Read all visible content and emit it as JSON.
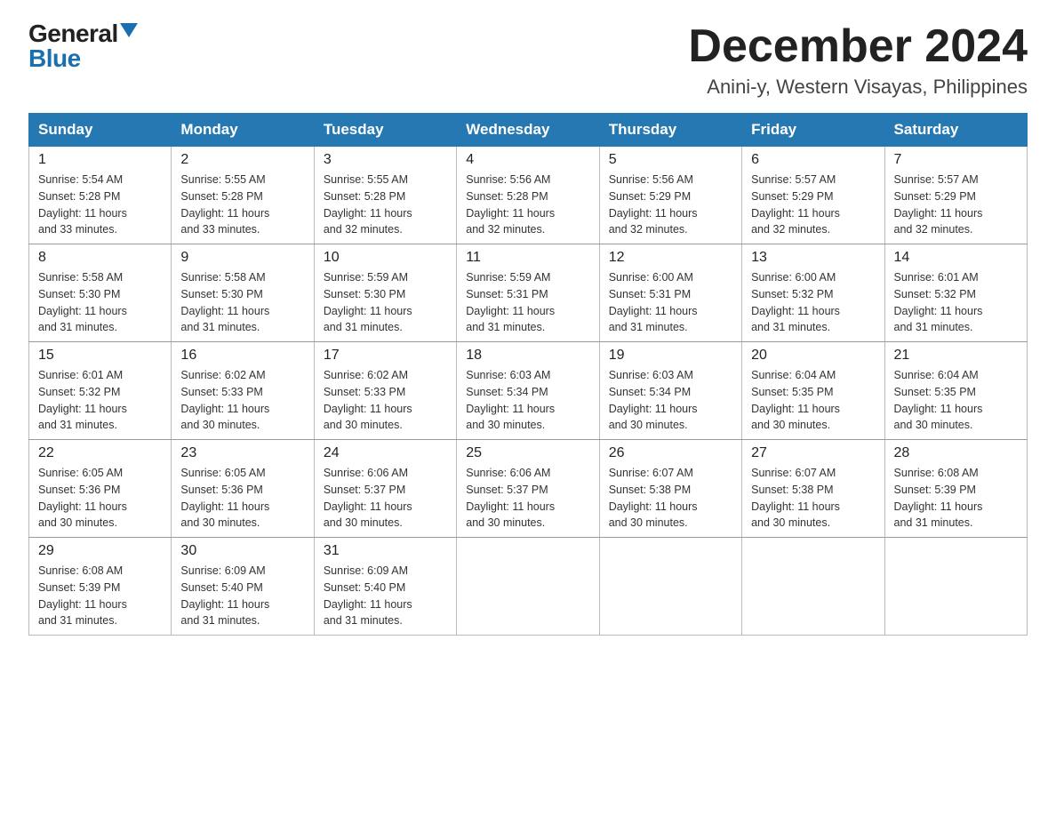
{
  "logo": {
    "general": "General",
    "blue": "Blue"
  },
  "title": {
    "month": "December 2024",
    "location": "Anini-y, Western Visayas, Philippines"
  },
  "weekdays": [
    "Sunday",
    "Monday",
    "Tuesday",
    "Wednesday",
    "Thursday",
    "Friday",
    "Saturday"
  ],
  "weeks": [
    [
      {
        "day": "1",
        "info": "Sunrise: 5:54 AM\nSunset: 5:28 PM\nDaylight: 11 hours\nand 33 minutes."
      },
      {
        "day": "2",
        "info": "Sunrise: 5:55 AM\nSunset: 5:28 PM\nDaylight: 11 hours\nand 33 minutes."
      },
      {
        "day": "3",
        "info": "Sunrise: 5:55 AM\nSunset: 5:28 PM\nDaylight: 11 hours\nand 32 minutes."
      },
      {
        "day": "4",
        "info": "Sunrise: 5:56 AM\nSunset: 5:28 PM\nDaylight: 11 hours\nand 32 minutes."
      },
      {
        "day": "5",
        "info": "Sunrise: 5:56 AM\nSunset: 5:29 PM\nDaylight: 11 hours\nand 32 minutes."
      },
      {
        "day": "6",
        "info": "Sunrise: 5:57 AM\nSunset: 5:29 PM\nDaylight: 11 hours\nand 32 minutes."
      },
      {
        "day": "7",
        "info": "Sunrise: 5:57 AM\nSunset: 5:29 PM\nDaylight: 11 hours\nand 32 minutes."
      }
    ],
    [
      {
        "day": "8",
        "info": "Sunrise: 5:58 AM\nSunset: 5:30 PM\nDaylight: 11 hours\nand 31 minutes."
      },
      {
        "day": "9",
        "info": "Sunrise: 5:58 AM\nSunset: 5:30 PM\nDaylight: 11 hours\nand 31 minutes."
      },
      {
        "day": "10",
        "info": "Sunrise: 5:59 AM\nSunset: 5:30 PM\nDaylight: 11 hours\nand 31 minutes."
      },
      {
        "day": "11",
        "info": "Sunrise: 5:59 AM\nSunset: 5:31 PM\nDaylight: 11 hours\nand 31 minutes."
      },
      {
        "day": "12",
        "info": "Sunrise: 6:00 AM\nSunset: 5:31 PM\nDaylight: 11 hours\nand 31 minutes."
      },
      {
        "day": "13",
        "info": "Sunrise: 6:00 AM\nSunset: 5:32 PM\nDaylight: 11 hours\nand 31 minutes."
      },
      {
        "day": "14",
        "info": "Sunrise: 6:01 AM\nSunset: 5:32 PM\nDaylight: 11 hours\nand 31 minutes."
      }
    ],
    [
      {
        "day": "15",
        "info": "Sunrise: 6:01 AM\nSunset: 5:32 PM\nDaylight: 11 hours\nand 31 minutes."
      },
      {
        "day": "16",
        "info": "Sunrise: 6:02 AM\nSunset: 5:33 PM\nDaylight: 11 hours\nand 30 minutes."
      },
      {
        "day": "17",
        "info": "Sunrise: 6:02 AM\nSunset: 5:33 PM\nDaylight: 11 hours\nand 30 minutes."
      },
      {
        "day": "18",
        "info": "Sunrise: 6:03 AM\nSunset: 5:34 PM\nDaylight: 11 hours\nand 30 minutes."
      },
      {
        "day": "19",
        "info": "Sunrise: 6:03 AM\nSunset: 5:34 PM\nDaylight: 11 hours\nand 30 minutes."
      },
      {
        "day": "20",
        "info": "Sunrise: 6:04 AM\nSunset: 5:35 PM\nDaylight: 11 hours\nand 30 minutes."
      },
      {
        "day": "21",
        "info": "Sunrise: 6:04 AM\nSunset: 5:35 PM\nDaylight: 11 hours\nand 30 minutes."
      }
    ],
    [
      {
        "day": "22",
        "info": "Sunrise: 6:05 AM\nSunset: 5:36 PM\nDaylight: 11 hours\nand 30 minutes."
      },
      {
        "day": "23",
        "info": "Sunrise: 6:05 AM\nSunset: 5:36 PM\nDaylight: 11 hours\nand 30 minutes."
      },
      {
        "day": "24",
        "info": "Sunrise: 6:06 AM\nSunset: 5:37 PM\nDaylight: 11 hours\nand 30 minutes."
      },
      {
        "day": "25",
        "info": "Sunrise: 6:06 AM\nSunset: 5:37 PM\nDaylight: 11 hours\nand 30 minutes."
      },
      {
        "day": "26",
        "info": "Sunrise: 6:07 AM\nSunset: 5:38 PM\nDaylight: 11 hours\nand 30 minutes."
      },
      {
        "day": "27",
        "info": "Sunrise: 6:07 AM\nSunset: 5:38 PM\nDaylight: 11 hours\nand 30 minutes."
      },
      {
        "day": "28",
        "info": "Sunrise: 6:08 AM\nSunset: 5:39 PM\nDaylight: 11 hours\nand 31 minutes."
      }
    ],
    [
      {
        "day": "29",
        "info": "Sunrise: 6:08 AM\nSunset: 5:39 PM\nDaylight: 11 hours\nand 31 minutes."
      },
      {
        "day": "30",
        "info": "Sunrise: 6:09 AM\nSunset: 5:40 PM\nDaylight: 11 hours\nand 31 minutes."
      },
      {
        "day": "31",
        "info": "Sunrise: 6:09 AM\nSunset: 5:40 PM\nDaylight: 11 hours\nand 31 minutes."
      },
      null,
      null,
      null,
      null
    ]
  ]
}
